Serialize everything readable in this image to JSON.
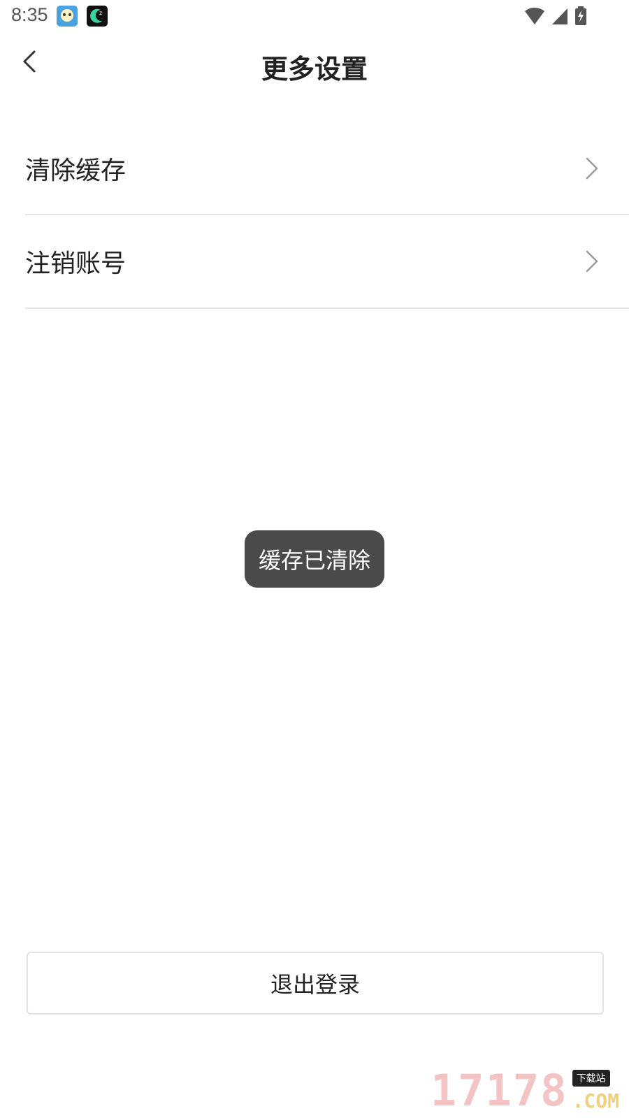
{
  "status_bar": {
    "time": "8:35"
  },
  "header": {
    "title": "更多设置"
  },
  "menu": {
    "items": [
      {
        "label": "清除缓存"
      },
      {
        "label": "注销账号"
      }
    ]
  },
  "toast": {
    "message": "缓存已清除"
  },
  "logout": {
    "label": "退出登录"
  },
  "watermark": {
    "number": "17178",
    "badge": "下载站",
    "domain": ".COM"
  },
  "colors": {
    "toast_bg": "#4a4a4a",
    "divider": "#e6e6e6",
    "text": "#222222"
  }
}
